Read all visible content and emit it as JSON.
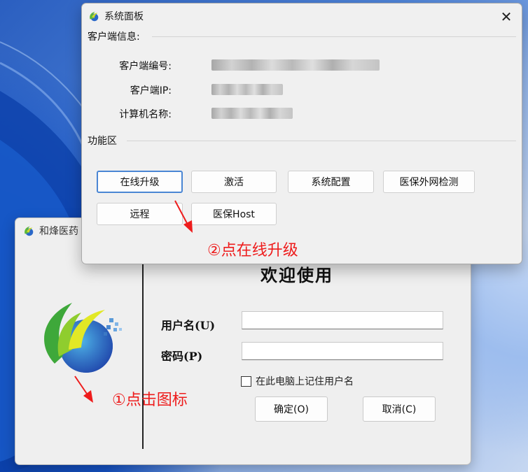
{
  "colors": {
    "annotation_red": "#ee1c1c",
    "focus_blue": "#4a86d4",
    "window_bg": "#f0f0f0"
  },
  "login_window": {
    "title": "和烽医药",
    "app_icon": "hefeng-logo-icon",
    "welcome": "欢迎使用",
    "username_label": "用户名(U)",
    "username_value": "",
    "password_label": "密码(P)",
    "password_value": "",
    "remember_label": "在此电脑上记住用户名",
    "remember_checked": false,
    "ok_button": "确定(O)",
    "cancel_button": "取消(C)"
  },
  "system_panel": {
    "title": "系统面板",
    "app_icon": "hefeng-logo-icon",
    "close_icon": "close-icon",
    "client_info_group": "客户端信息:",
    "client_id_label": "客户端编号:",
    "client_id_value": "",
    "client_ip_label": "客户端IP:",
    "client_ip_value": "",
    "computer_name_label": "计算机名称:",
    "computer_name_value": "",
    "function_group": "功能区",
    "buttons": {
      "online_upgrade": "在线升级",
      "activate": "激活",
      "system_config": "系统配置",
      "medical_network_check": "医保外网检测",
      "remote": "远程",
      "medical_host": "医保Host"
    }
  },
  "annotations": {
    "step1": "①点击图标",
    "step2": "②点在线升级"
  }
}
